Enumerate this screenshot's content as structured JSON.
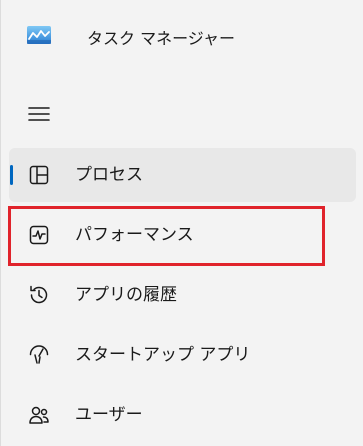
{
  "window": {
    "title": "タスク マネージャー"
  },
  "icons": {
    "app": "task-manager-app-icon",
    "menu": "hamburger-menu-icon"
  },
  "nav": {
    "items": [
      {
        "label": "プロセス",
        "icon": "processes-icon",
        "selected": true
      },
      {
        "label": "パフォーマンス",
        "icon": "performance-icon",
        "selected": false,
        "highlighted": true
      },
      {
        "label": "アプリの履歴",
        "icon": "app-history-icon",
        "selected": false
      },
      {
        "label": "スタートアップ アプリ",
        "icon": "startup-apps-icon",
        "selected": false
      },
      {
        "label": "ユーザー",
        "icon": "users-icon",
        "selected": false
      }
    ]
  },
  "colors": {
    "accent": "#0067c0",
    "highlight": "#e0232b",
    "background": "#f3f3f3",
    "selected_background": "#e8e8e8"
  }
}
